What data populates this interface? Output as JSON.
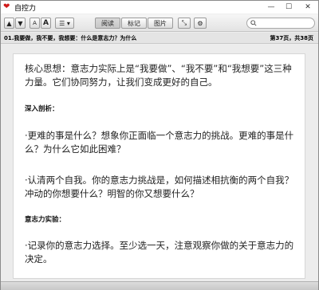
{
  "window": {
    "title": "自控力",
    "controls": {
      "minimize": "—",
      "maximize": "☐",
      "close": "✕"
    }
  },
  "toolbar": {
    "up": "▲",
    "down": "▼",
    "font_smaller": "A",
    "font_larger": "A",
    "view_menu": "☰ ▾",
    "tab_reading": "阅读",
    "tab_notes": "标记",
    "tab_images": "图片",
    "fullscreen": "⤡",
    "settings": "⚙",
    "search_placeholder": ""
  },
  "infobar": {
    "path": "01.我要做，我不要，我想要：什么是意志力？为什么",
    "page_indicator": "第37页，共38页"
  },
  "content": {
    "intro": "核心思想：意志力实际上是“我要做”、“我不要”和“我想要”这三种力量。它们协同努力，让我们变成更好的自己。",
    "heading1": "深入剖析：",
    "q1": "·更难的事是什么？想象你正面临一个意志力的挑战。更难的事是什么？为什么它如此困难？",
    "q2": "·认清两个自我。你的意志力挑战是，如何描述相抗衡的两个自我？冲动的你想要什么？明智的你又想要什么？",
    "heading2": "意志力实验：",
    "exp1": "·记录你的意志力选择。至少选一天，注意观察你做的关于意志力的决定。"
  }
}
